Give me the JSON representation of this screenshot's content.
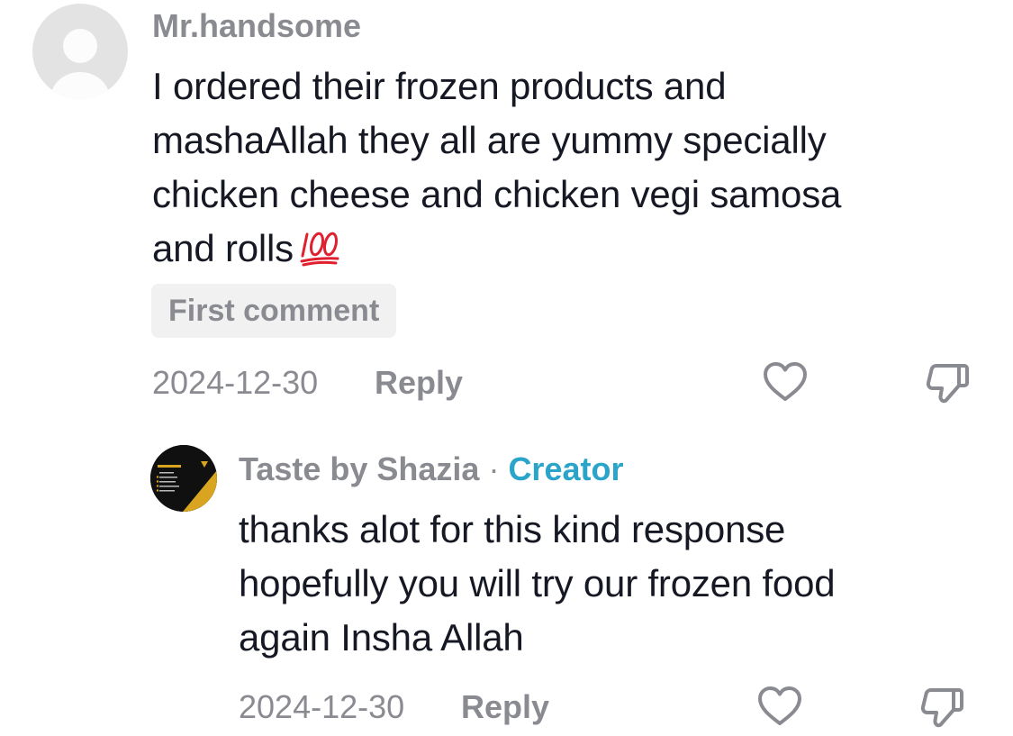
{
  "comments": [
    {
      "username": "Mr.handsome",
      "text": "I ordered their frozen products and\nmashaAllah they all are yummy specially\nchicken cheese and chicken vegi samosa\nand rolls",
      "emoji": "hundred-points-emoji",
      "badge": "First comment",
      "date": "2024-12-30",
      "reply_label": "Reply"
    }
  ],
  "replies": [
    {
      "username": "Taste by Shazia",
      "separator": " · ",
      "creator_label": "Creator",
      "text": "thanks alot for this kind response\nhopefully you will try our frozen food\nagain Insha Allah",
      "date": "2024-12-30",
      "reply_label": "Reply"
    }
  ],
  "icons": {
    "like": "heart-outline-icon",
    "dislike": "thumbs-down-outline-icon",
    "default_avatar": "default-user-avatar",
    "emoji": "hundred-points-emoji"
  },
  "colors": {
    "text_primary": "#161823",
    "text_secondary": "#8a8b91",
    "creator_accent": "#2aa4c9",
    "badge_bg": "#f1f1f2",
    "emoji_red": "#e0202f"
  }
}
